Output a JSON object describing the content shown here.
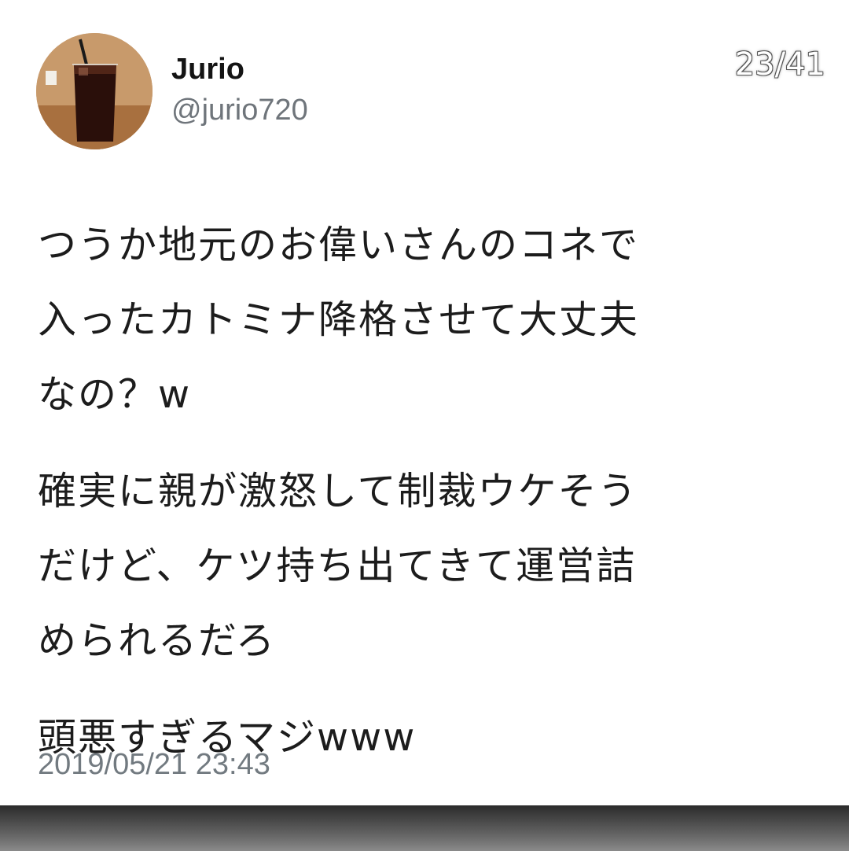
{
  "page_counter": "23/41",
  "user": {
    "display_name": "Jurio",
    "handle": "@jurio720",
    "avatar": "avatar-photo-iced-drink"
  },
  "tweet": {
    "paragraphs": [
      "つうか地元のお偉いさんのコネで\n入ったカトミナ降格させて大丈夫\nなの？w",
      "確実に親が激怒して制裁ウケそう\nだけど、ケツ持ち出てきて運営詰\nめられるだろ",
      "頭悪すぎるマジwww"
    ],
    "timestamp": "2019/05/21 23:43"
  },
  "colors": {
    "background": "#ffffff",
    "text": "#1c1c1c",
    "secondary_text": "#6f757b"
  }
}
